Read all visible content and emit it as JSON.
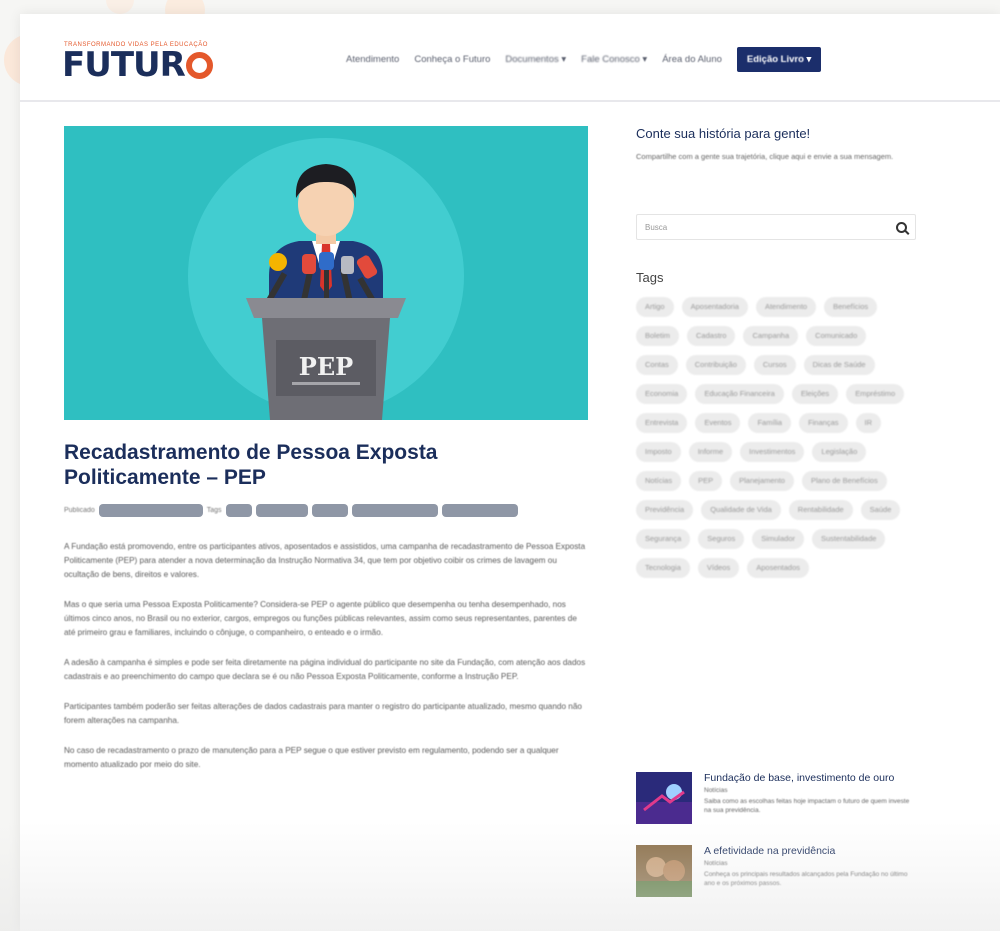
{
  "header": {
    "tagline": "TRANSFORMANDO VIDAS PELA EDUCAÇÃO",
    "logo_text": "FUTUR",
    "nav": [
      "Atendimento",
      "Conheça o Futuro",
      "Documentos",
      "Fale Conosco",
      "Área do Aluno"
    ],
    "nav_dropdown_flags": [
      false,
      false,
      true,
      true,
      false
    ],
    "cta_label": "Edição Livro"
  },
  "hero": {
    "podium_text": "PEP"
  },
  "article": {
    "title": "Recadastramento de Pessoa Exposta Politicamente – PEP",
    "meta_prefix": "Publicado",
    "meta_mid": "Tags",
    "paragraphs": [
      "A Fundação está promovendo, entre os participantes ativos, aposentados e assistidos, uma campanha de recadastramento de Pessoa Exposta Politicamente (PEP) para atender a nova determinação da Instrução Normativa 34, que tem por objetivo coibir os crimes de lavagem ou ocultação de bens, direitos e valores.",
      "Mas o que seria uma Pessoa Exposta Politicamente? Considera-se PEP o agente público que desempenha ou tenha desempenhado, nos últimos cinco anos, no Brasil ou no exterior, cargos, empregos ou funções públicas relevantes, assim como seus representantes, parentes de até primeiro grau e familiares, incluindo o cônjuge, o companheiro, o enteado e o irmão.",
      "A adesão à campanha é simples e pode ser feita diretamente na página individual do participante no site da Fundação, com atenção aos dados cadastrais e ao preenchimento do campo que declara se é ou não Pessoa Exposta Politicamente, conforme a Instrução PEP.",
      "Participantes também poderão ser feitas alterações de dados cadastrais para manter o registro do participante atualizado, mesmo quando não forem alterações na campanha.",
      "No caso de recadastramento o prazo de manutenção para a PEP segue o que estiver previsto em regulamento, podendo ser a qualquer momento atualizado por meio do site."
    ]
  },
  "sidebar": {
    "story_title": "Conte sua história para gente!",
    "story_text": "Compartilhe com a gente sua trajetória, clique aqui e envie a sua mensagem.",
    "search_placeholder": "Busca",
    "tags_title": "Tags",
    "tags": [
      "Artigo",
      "Aposentadoria",
      "Atendimento",
      "Benefícios",
      "Boletim",
      "Cadastro",
      "Campanha",
      "Comunicado",
      "Contas",
      "Contribuição",
      "Cursos",
      "Dicas de Saúde",
      "Economia",
      "Educação Financeira",
      "Eleições",
      "Empréstimo",
      "Entrevista",
      "Eventos",
      "Família",
      "Finanças",
      "IR",
      "Imposto",
      "Informe",
      "Investimentos",
      "Legislação",
      "Notícias",
      "PEP",
      "Planejamento",
      "Plano de Benefícios",
      "Previdência",
      "Qualidade de Vida",
      "Rentabilidade",
      "Saúde",
      "Segurança",
      "Seguros",
      "Simulador",
      "Sustentabilidade",
      "Tecnologia",
      "Vídeos",
      "Aposentados"
    ],
    "posts": [
      {
        "title": "Fundação de base, investimento de ouro",
        "meta": "Notícias",
        "excerpt": "Saiba como as escolhas feitas hoje impactam o futuro de quem investe na sua previdência."
      },
      {
        "title": "A efetividade na previdência",
        "meta": "Notícias",
        "excerpt": "Conheça os principais resultados alcançados pela Fundação no último ano e os próximos passos."
      }
    ]
  },
  "colors": {
    "brand_navy": "#1b2e5b",
    "brand_orange": "#e4582b",
    "hero_teal": "#2fbfc1"
  }
}
